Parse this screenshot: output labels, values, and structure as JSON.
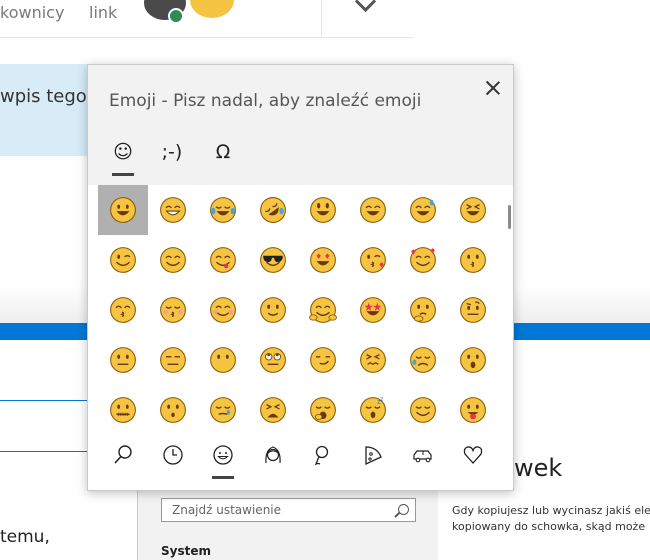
{
  "background": {
    "top_links": [
      "kownicy",
      "link"
    ],
    "blue_text": "wpis tego",
    "left_text_1": "temu,",
    "left_text_2": "",
    "settings_search_placeholder": "Znajdź ustawienie",
    "settings_section": "System",
    "heading_fragment": "wek",
    "paragraph_lines": [
      "Gdy kopiujesz lub wycinasz jakiś ele",
      "kopiowany do schowka, skąd może"
    ]
  },
  "emoji_panel": {
    "title": "Emoji - Pisz nadal, aby znaleźć emoji",
    "tabs": [
      {
        "label": "☺",
        "icon": "emoji-tab-icon",
        "active": true
      },
      {
        "label": ";-)",
        "icon": "kaomoji-tab-icon",
        "active": false
      },
      {
        "label": "Ω",
        "icon": "symbols-tab-icon",
        "active": false
      }
    ],
    "colors": {
      "face": "#f6c443",
      "outline": "#8a5a00",
      "mouth": "#6b3a00",
      "heart": "#e8334a",
      "tear": "#4aa3df",
      "selected": "#b0b0b0"
    },
    "emoji_rows": [
      [
        "grinning-face",
        "beaming-face",
        "face-with-tears-of-joy",
        "rolling-on-floor-laughing",
        "grinning-face-big-eyes",
        "grinning-smiling-eyes",
        "grinning-face-with-sweat",
        "grinning-squinting-face"
      ],
      [
        "winking-face",
        "smiling-face-smiling-eyes",
        "face-savoring-food",
        "smiling-face-sunglasses",
        "heart-eyes-face",
        "face-blowing-kiss",
        "smiling-face-with-hearts",
        "kissing-face"
      ],
      [
        "kissing-smiling-eyes",
        "kissing-closed-eyes",
        "smiling-face",
        "slightly-smiling-face",
        "hugging-face",
        "star-struck",
        "thinking-face",
        "face-raised-eyebrow"
      ],
      [
        "neutral-face",
        "expressionless-face",
        "face-without-mouth",
        "face-rolling-eyes",
        "smirking-face",
        "persevering-face",
        "sad-but-relieved-face",
        "face-open-mouth"
      ],
      [
        "zipper-mouth-face",
        "hushed-face",
        "sleepy-face",
        "tired-face",
        "yawning-face",
        "sleeping-face",
        "relieved-face",
        "face-with-tongue"
      ]
    ],
    "selected_emoji": "grinning-face",
    "categories": [
      {
        "icon": "search-icon",
        "active": false
      },
      {
        "icon": "clock-icon",
        "active": false
      },
      {
        "icon": "smiley-icon",
        "active": true
      },
      {
        "icon": "person-icon",
        "active": false
      },
      {
        "icon": "location-pin-icon",
        "active": false
      },
      {
        "icon": "pizza-icon",
        "active": false
      },
      {
        "icon": "car-icon",
        "active": false
      },
      {
        "icon": "heart-icon",
        "active": false
      }
    ]
  }
}
